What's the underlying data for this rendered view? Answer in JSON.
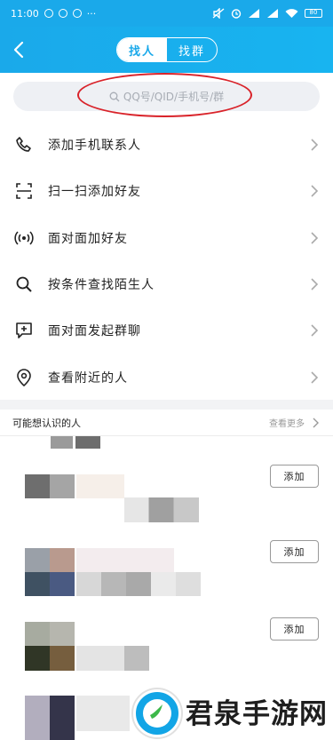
{
  "status_bar": {
    "time": "11:00",
    "dots": "···",
    "battery": "80"
  },
  "header": {
    "tabs": [
      "找人",
      "找群"
    ]
  },
  "search": {
    "placeholder": "QQ号/QID/手机号/群"
  },
  "menu": {
    "items": [
      {
        "label": "添加手机联系人",
        "icon": "phone-icon"
      },
      {
        "label": "扫一扫添加好友",
        "icon": "scan-icon"
      },
      {
        "label": "面对面加好友",
        "icon": "broadcast-icon"
      },
      {
        "label": "按条件查找陌生人",
        "icon": "search-icon"
      },
      {
        "label": "面对面发起群聊",
        "icon": "add-chat-icon"
      },
      {
        "label": "查看附近的人",
        "icon": "location-pin-icon"
      }
    ]
  },
  "suggestions": {
    "title": "可能想认识的人",
    "more": "查看更多",
    "add_label": "添加"
  },
  "watermark": {
    "text": "君泉手游网"
  },
  "colors": {
    "accent": "#1aa9ea",
    "annotation": "#d9232a"
  }
}
